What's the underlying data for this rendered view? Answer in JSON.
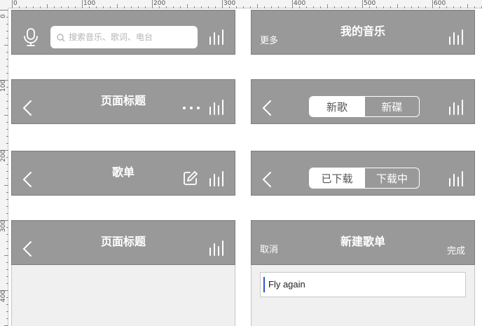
{
  "ruler": {
    "h_labels": [
      "0",
      "100",
      "200",
      "300",
      "400",
      "500",
      "600"
    ],
    "v_labels": [
      "0",
      "100",
      "200",
      "300",
      "400"
    ]
  },
  "colors": {
    "bar_bg": "#999999",
    "bar_text": "#ffffff",
    "caret": "#2f56c8"
  },
  "search_bar": {
    "placeholder": "搜索音乐、歌词、电台",
    "icons": [
      "microphone-icon",
      "search-icon",
      "equalizer-icon"
    ]
  },
  "my_music_bar": {
    "left_label": "更多",
    "title": "我的音乐",
    "icons": [
      "equalizer-icon"
    ]
  },
  "page_bar_more": {
    "title": "页面标题",
    "icons": [
      "back-icon",
      "more-icon",
      "equalizer-icon"
    ]
  },
  "segment_songs": {
    "tabs": [
      "新歌",
      "新碟"
    ],
    "selected": "新歌",
    "icons": [
      "back-icon",
      "equalizer-icon"
    ]
  },
  "playlist_bar": {
    "title": "歌单",
    "icons": [
      "back-icon",
      "edit-icon",
      "equalizer-icon"
    ]
  },
  "segment_download": {
    "tabs": [
      "已下载",
      "下载中"
    ],
    "selected": "已下载",
    "icons": [
      "back-icon",
      "equalizer-icon"
    ]
  },
  "page_bar_plain": {
    "title": "页面标题",
    "icons": [
      "back-icon",
      "equalizer-icon"
    ]
  },
  "new_playlist": {
    "cancel_label": "取消",
    "title": "新建歌单",
    "done_label": "完成",
    "input_value": "Fly again"
  }
}
